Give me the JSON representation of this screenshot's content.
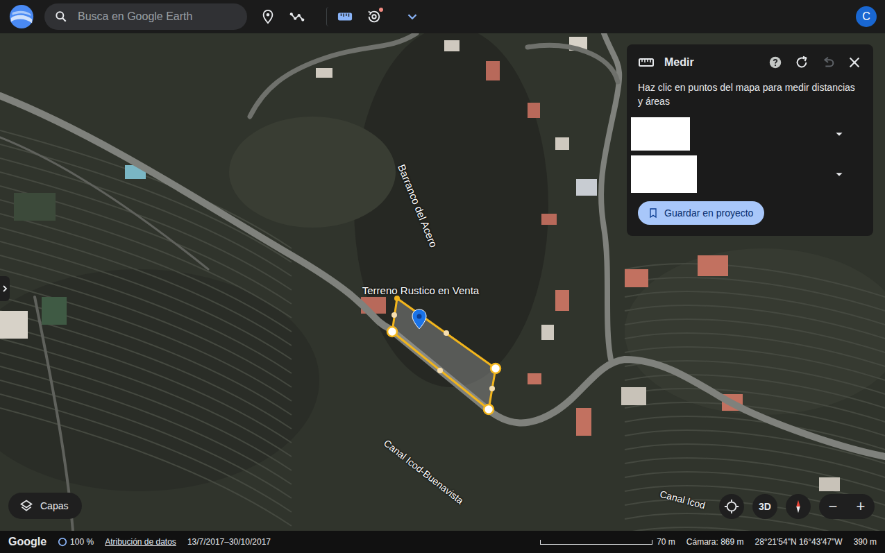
{
  "topbar": {
    "search_placeholder": "Busca en Google Earth",
    "avatar": "C",
    "tools": [
      {
        "selected": false,
        "badge": false
      },
      {
        "selected": false,
        "badge": false
      },
      {
        "selected": true,
        "badge": false
      },
      {
        "selected": false,
        "badge": true
      }
    ]
  },
  "map": {
    "labels": [
      {
        "text": "Barranco del Acero"
      },
      {
        "text": "Canal Icod-Buenavista"
      },
      {
        "text": "Canal Icod"
      }
    ],
    "placemark": {
      "label": "Terreno Rustico en Venta"
    }
  },
  "measure_panel": {
    "title": "Medir",
    "instruction": "Haz clic en puntos del mapa para medir distancias y áreas",
    "undo_disabled": true,
    "fields": [
      {
        "redacted": true
      },
      {
        "redacted": true
      }
    ],
    "save_button": "Guardar en proyecto"
  },
  "controls": {
    "layers_button": "Capas",
    "view_3d": "3D",
    "zoom_out": "−",
    "zoom_in": "+"
  },
  "status_bar": {
    "brand": "Google",
    "load": "100 %",
    "attribution": "Atribución de datos",
    "dates": "13/7/2017–30/10/2017",
    "scale": "70 m",
    "camera": "Cámara: 869 m",
    "coords": "28°21'54\"N 16°43'47\"W",
    "elevation": "390 m"
  }
}
